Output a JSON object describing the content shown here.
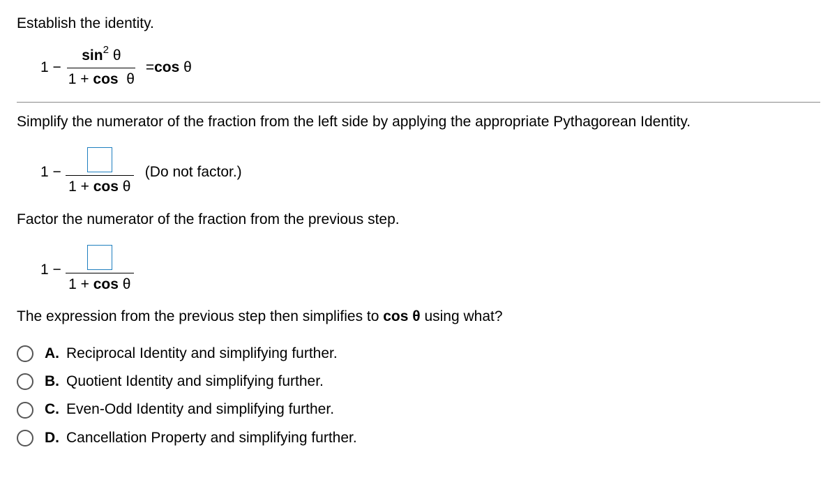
{
  "prompt": "Establish the identity.",
  "equation": {
    "left_prefix": "1 −",
    "numerator_a": "sin",
    "numerator_exp": "2",
    "numerator_theta": "θ",
    "denominator": "1 + cos  θ",
    "equals": "= cos  θ"
  },
  "step1": {
    "text": "Simplify the numerator of the fraction from the left side by applying the appropriate Pythagorean Identity.",
    "left_prefix": "1 −",
    "denominator": "1 + cos θ",
    "hint": "(Do not factor.)"
  },
  "step2": {
    "text": "Factor the numerator of the fraction from the previous step.",
    "left_prefix": "1 −",
    "denominator": "1 + cos θ"
  },
  "question": {
    "text_a": "The expression from the previous step then simplifies to ",
    "text_bold": "cos  θ",
    "text_b": " using what?"
  },
  "options": [
    {
      "letter": "A.",
      "text": "Reciprocal Identity and simplifying further."
    },
    {
      "letter": "B.",
      "text": "Quotient Identity and simplifying further."
    },
    {
      "letter": "C.",
      "text": "Even-Odd Identity and simplifying further."
    },
    {
      "letter": "D.",
      "text": "Cancellation Property and simplifying further."
    }
  ]
}
